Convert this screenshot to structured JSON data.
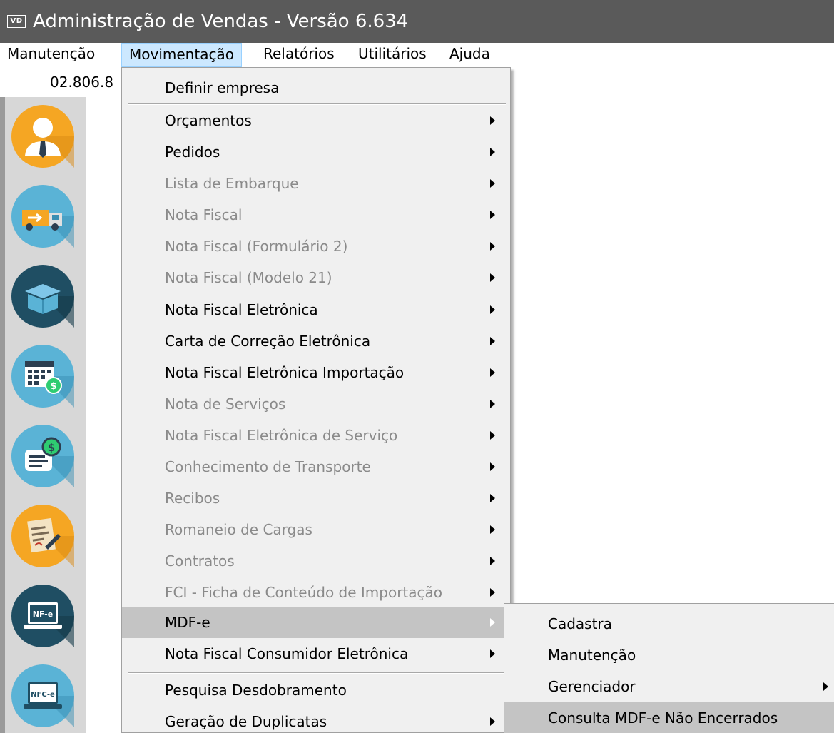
{
  "window": {
    "app_icon_text": "VD",
    "title": "Administração de Vendas - Versão 6.634"
  },
  "menubar": {
    "items": [
      {
        "label": "Manutenção"
      },
      {
        "label": "Movimentação"
      },
      {
        "label": "Relatórios"
      },
      {
        "label": "Utilitários"
      },
      {
        "label": "Ajuda"
      }
    ]
  },
  "company": {
    "cnpj_partial": "02.806.8"
  },
  "toolbar": {
    "icons": [
      "user-icon",
      "truck-icon",
      "box-icon",
      "calendar-money-icon",
      "invoice-money-icon",
      "contract-icon",
      "nfe-laptop-icon",
      "nfce-laptop-icon"
    ],
    "laptop_labels": [
      "NF-e",
      "NFC-e"
    ]
  },
  "movimentacao_menu": {
    "items": [
      {
        "label": "Definir empresa",
        "enabled": true,
        "submenu": false
      },
      {
        "label": "Orçamentos",
        "enabled": true,
        "submenu": true
      },
      {
        "label": "Pedidos",
        "enabled": true,
        "submenu": true
      },
      {
        "label": "Lista de Embarque",
        "enabled": false,
        "submenu": true
      },
      {
        "label": "Nota Fiscal",
        "enabled": false,
        "submenu": true
      },
      {
        "label": "Nota Fiscal (Formulário 2)",
        "enabled": false,
        "submenu": true
      },
      {
        "label": "Nota Fiscal (Modelo 21)",
        "enabled": false,
        "submenu": true
      },
      {
        "label": "Nota Fiscal Eletrônica",
        "enabled": true,
        "submenu": true
      },
      {
        "label": "Carta de Correção Eletrônica",
        "enabled": true,
        "submenu": true
      },
      {
        "label": "Nota Fiscal Eletrônica Importação",
        "enabled": true,
        "submenu": true
      },
      {
        "label": "Nota de Serviços",
        "enabled": false,
        "submenu": true
      },
      {
        "label": "Nota Fiscal Eletrônica de Serviço",
        "enabled": false,
        "submenu": true
      },
      {
        "label": "Conhecimento de Transporte",
        "enabled": false,
        "submenu": true
      },
      {
        "label": "Recibos",
        "enabled": false,
        "submenu": true
      },
      {
        "label": "Romaneio de Cargas",
        "enabled": false,
        "submenu": true
      },
      {
        "label": "Contratos",
        "enabled": false,
        "submenu": true
      },
      {
        "label": "FCI - Ficha de Conteúdo de Importação",
        "enabled": false,
        "submenu": true
      },
      {
        "label": "MDF-e",
        "enabled": true,
        "submenu": true,
        "highlighted": true
      },
      {
        "label": "Nota Fiscal Consumidor Eletrônica",
        "enabled": true,
        "submenu": true
      },
      {
        "label": "Pesquisa Desdobramento",
        "enabled": true,
        "submenu": false
      },
      {
        "label": "Geração de Duplicatas",
        "enabled": true,
        "submenu": true
      }
    ]
  },
  "mdfe_submenu": {
    "items": [
      {
        "label": "Cadastra",
        "submenu": false
      },
      {
        "label": "Manutenção",
        "submenu": false
      },
      {
        "label": "Gerenciador",
        "submenu": true
      },
      {
        "label": "Consulta MDF-e Não Encerrados",
        "submenu": false,
        "highlighted": true
      }
    ]
  },
  "colors": {
    "titlebar": "#5a5a5a",
    "menu_bg": "#f0f0f0",
    "highlight": "#c4c4c4",
    "disabled_text": "#8a8a8a",
    "active_menubar": "#cce8ff"
  }
}
